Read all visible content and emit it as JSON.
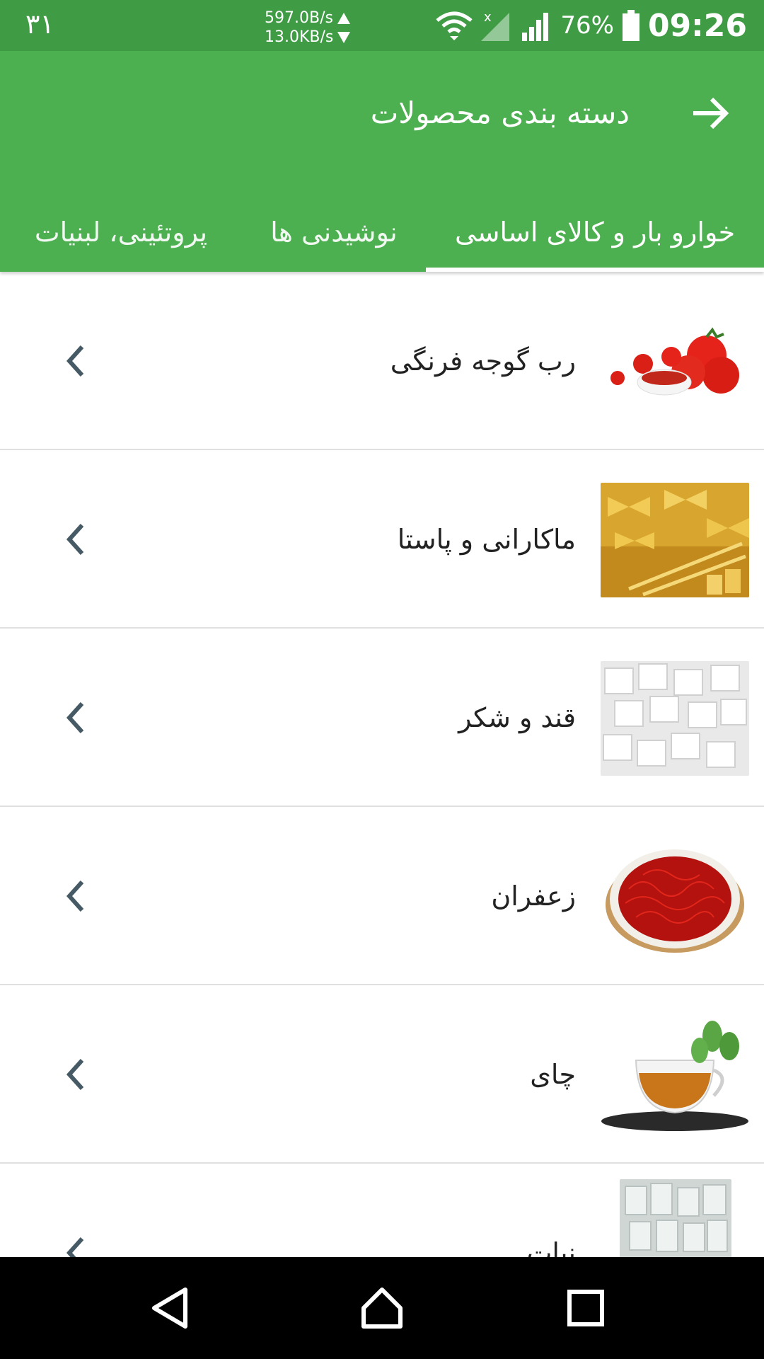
{
  "status_bar": {
    "left_number": "۳۱",
    "upload_speed": "597.0B/s",
    "download_speed": "13.0KB/s",
    "battery_percent": "76%",
    "time": "09:26",
    "icons": [
      "wifi-icon",
      "signal-no-sim-icon",
      "signal-icon",
      "battery-icon"
    ]
  },
  "app_bar": {
    "title": "دسته بندی محصولات",
    "back_icon": "arrow-right-icon",
    "color": "#4caf50"
  },
  "tabs": [
    {
      "label": "خوارو بار و کالای اساسی",
      "active": true
    },
    {
      "label": "نوشیدنی ها",
      "active": false
    },
    {
      "label": "پروتئینی، لبنیات",
      "active": false
    }
  ],
  "categories": [
    {
      "label": "رب گوجه فرنگی",
      "image": "tomato-paste-image"
    },
    {
      "label": "ماکارانی و پاستا",
      "image": "pasta-image"
    },
    {
      "label": "قند و شکر",
      "image": "sugar-cubes-image"
    },
    {
      "label": "زعفران",
      "image": "saffron-image"
    },
    {
      "label": "چای",
      "image": "tea-image"
    },
    {
      "label": "نبات",
      "image": "rock-candy-image"
    }
  ],
  "nav_bar": {
    "icons": [
      "back-triangle-icon",
      "home-icon",
      "recents-square-icon"
    ]
  }
}
